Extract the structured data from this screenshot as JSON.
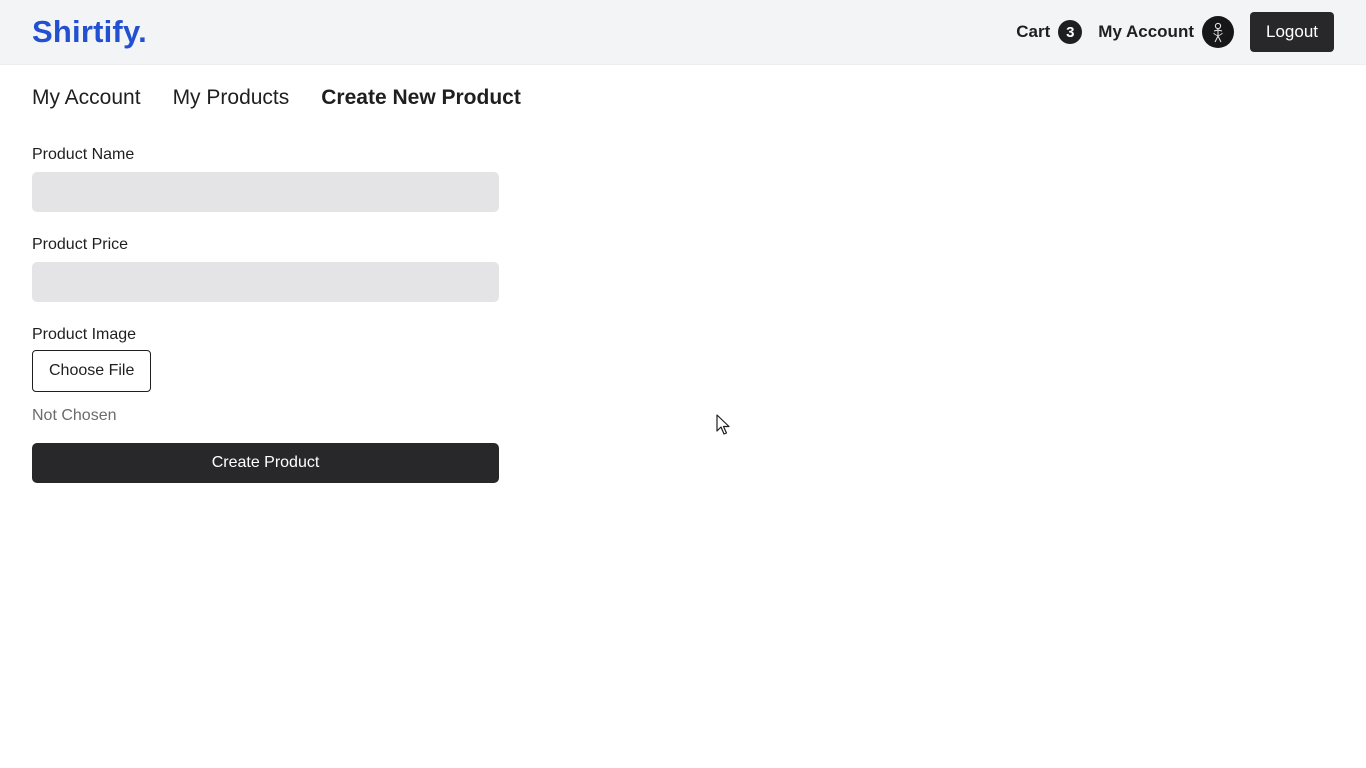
{
  "header": {
    "brand": "Shirtify.",
    "cart_label": "Cart",
    "cart_count": "3",
    "account_label": "My Account",
    "avatar_icon": "avatar-icon",
    "logout_label": "Logout",
    "brand_color": "#2350d0"
  },
  "tabs": [
    {
      "label": "My Account",
      "active": false
    },
    {
      "label": "My Products",
      "active": false
    },
    {
      "label": "Create New Product",
      "active": true
    }
  ],
  "form": {
    "name_label": "Product Name",
    "name_value": "",
    "price_label": "Product Price",
    "price_value": "",
    "image_label": "Product Image",
    "choose_file_label": "Choose File",
    "file_status": "Not Chosen",
    "submit_label": "Create Product"
  },
  "colors": {
    "header_bg": "#f3f4f6",
    "dark_button": "#28282b",
    "input_bg": "#e4e4e7"
  }
}
